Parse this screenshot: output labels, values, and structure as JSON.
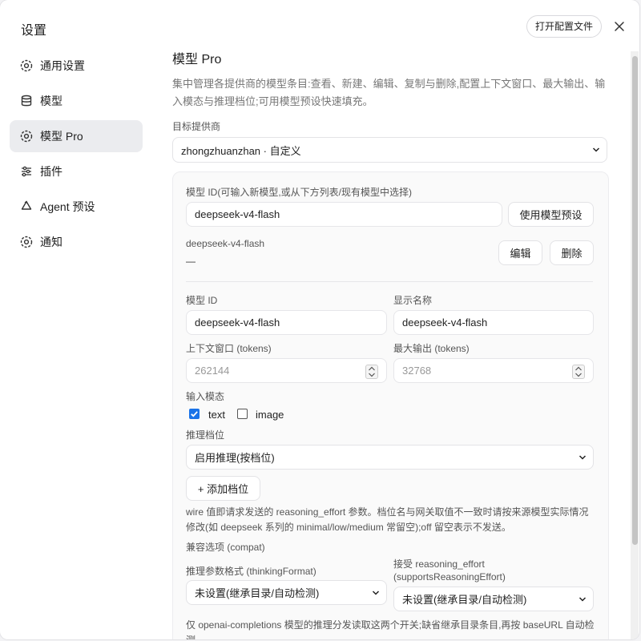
{
  "dialog": {
    "title": "设置",
    "open_config_label": "打开配置文件"
  },
  "sidebar": {
    "items": [
      {
        "label": "通用设置",
        "icon": "gear-icon",
        "active": false
      },
      {
        "label": "模型",
        "icon": "database-icon",
        "active": false
      },
      {
        "label": "模型 Pro",
        "icon": "gear-icon",
        "active": true
      },
      {
        "label": "插件",
        "icon": "sliders-icon",
        "active": false
      },
      {
        "label": "Agent 预设",
        "icon": "recycle-icon",
        "active": false
      },
      {
        "label": "通知",
        "icon": "gear-icon",
        "active": false
      }
    ]
  },
  "main": {
    "title": "模型 Pro",
    "description": "集中管理各提供商的模型条目:查看、新建、编辑、复制与删除,配置上下文窗口、最大输出、输入模态与推理档位;可用模型预设快速填充。",
    "provider_label": "目标提供商",
    "provider_value": "zhongzhuanzhan · 自定义",
    "model_id_entry_label": "模型 ID(可输入新模型,或从下方列表/现有模型中选择)",
    "model_id_entry_value": "deepseek-v4-flash",
    "use_preset_label": "使用模型预设",
    "current_model_name": "deepseek-v4-flash",
    "current_model_sub": "—",
    "edit_label": "编辑",
    "delete_label": "删除",
    "model_id_label": "模型 ID",
    "model_id_value": "deepseek-v4-flash",
    "display_name_label": "显示名称",
    "display_name_value": "deepseek-v4-flash",
    "context_label": "上下文窗口 (tokens)",
    "context_placeholder": "262144",
    "max_output_label": "最大输出 (tokens)",
    "max_output_placeholder": "32768",
    "modalities_label": "输入模态",
    "modality_text": "text",
    "modality_text_checked": true,
    "modality_image": "image",
    "modality_image_checked": false,
    "reasoning_label": "推理档位",
    "reasoning_value": "启用推理(按档位)",
    "add_level_label": "+ 添加档位",
    "wire_note": "wire 值即请求发送的 reasoning_effort 参数。档位名与网关取值不一致时请按来源模型实际情况修改(如 deepseek 系列的 minimal/low/medium 常留空);off 留空表示不发送。",
    "compat_label": "兼容选项 (compat)",
    "thinking_format_label": "推理参数格式 (thinkingFormat)",
    "thinking_format_value": "未设置(继承目录/自动检测)",
    "supports_effort_label_1": "接受 reasoning_effort",
    "supports_effort_label_2": "(supportsReasoningEffort)",
    "supports_effort_value": "未设置(继承目录/自动检测)",
    "bottom_note": "仅 openai-completions 模型的推理分发读取这两个开关;缺省继承目录条目,再按 baseURL 自动检测。"
  }
}
